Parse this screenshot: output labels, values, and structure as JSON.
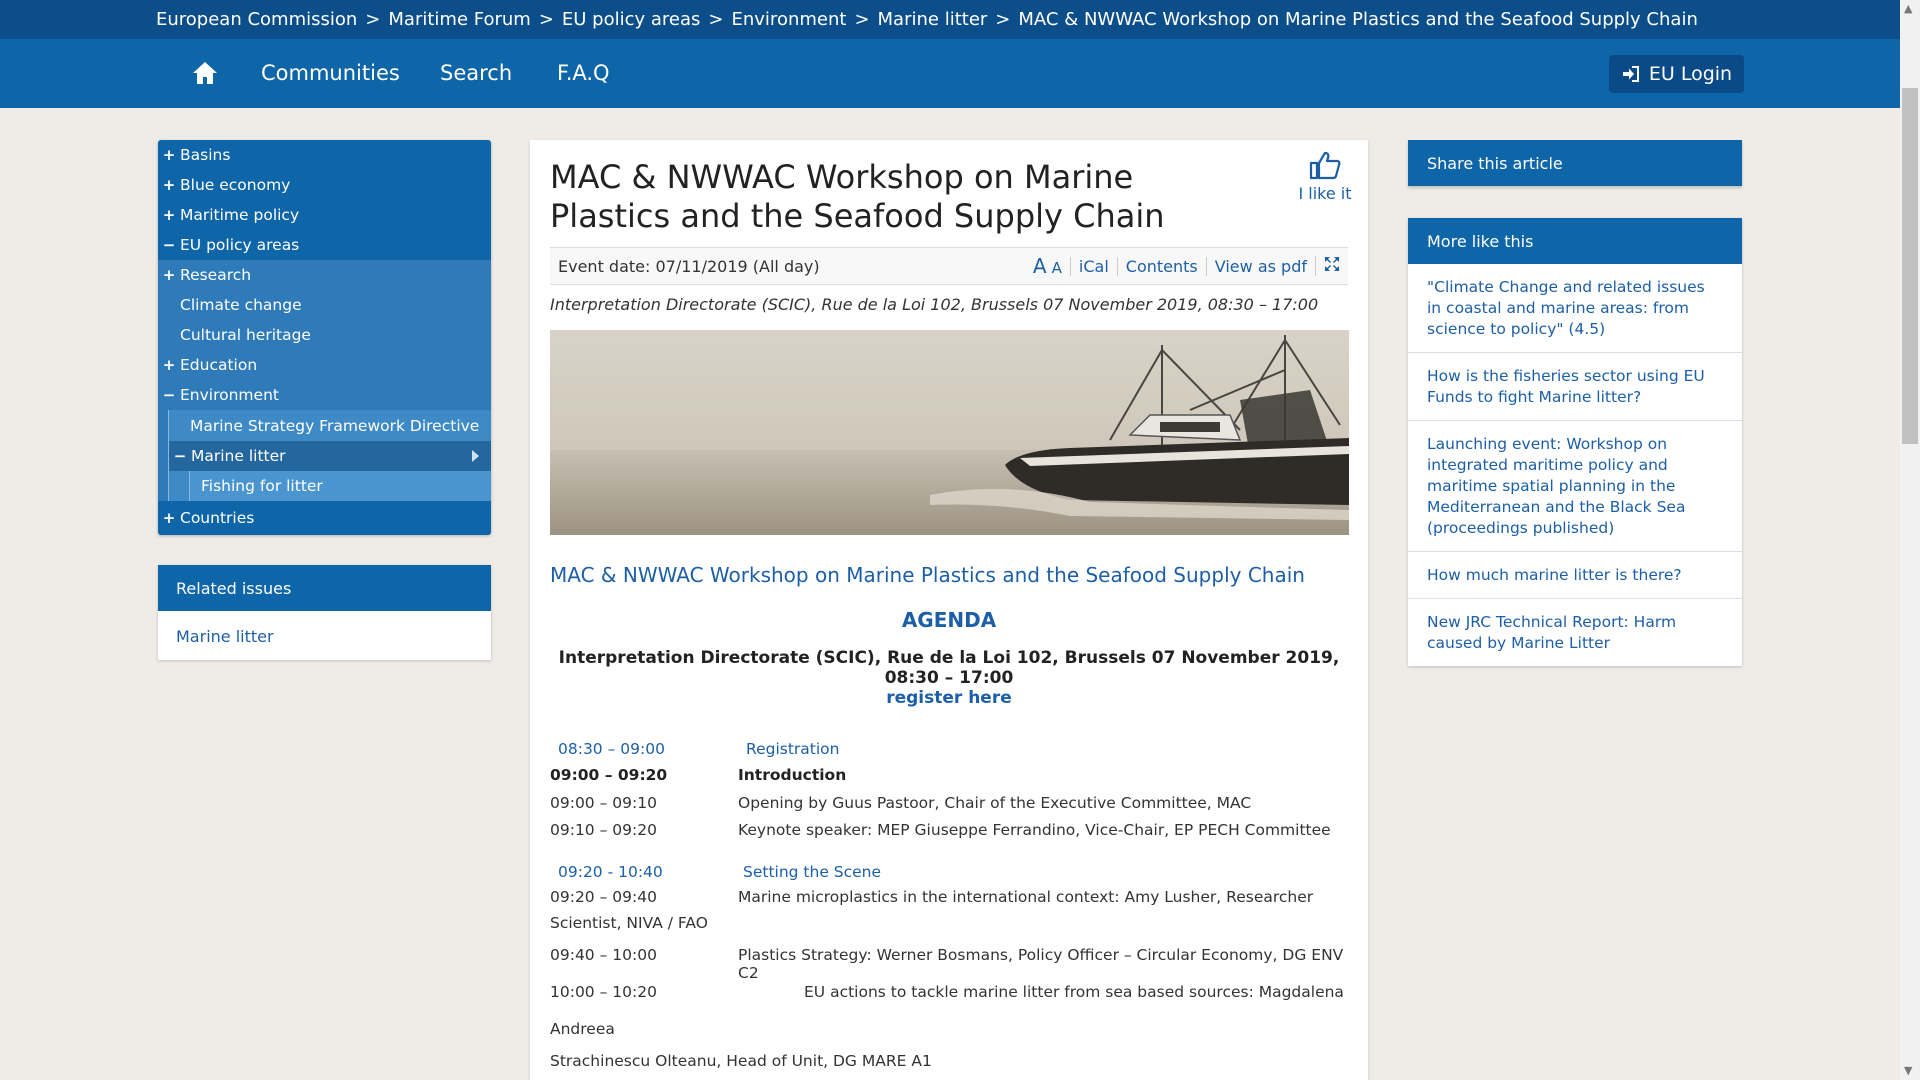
{
  "breadcrumb": [
    "European Commission",
    "Maritime Forum",
    "EU policy areas",
    "Environment",
    "Marine litter",
    "MAC & NWWAC Workshop on Marine Plastics and the Seafood Supply Chain"
  ],
  "breadcrumb_separator": ">",
  "nav": {
    "home_icon": "home-icon",
    "communities": "Communities",
    "search": "Search",
    "faq": "F.A.Q",
    "login": "EU Login"
  },
  "left_nav": {
    "basins": "Basins",
    "blue_economy": "Blue economy",
    "maritime_policy": "Maritime policy",
    "eu_policy_areas": "EU policy areas",
    "research": "Research",
    "climate_change": "Climate change",
    "cultural_heritage": "Cultural heritage",
    "education": "Education",
    "environment": "Environment",
    "msfd": "Marine Strategy Framework Directive",
    "marine_litter": "Marine litter",
    "fishing_for_litter": "Fishing for litter",
    "countries": "Countries"
  },
  "related": {
    "heading": "Related issues",
    "link": "Marine litter"
  },
  "article": {
    "title": "MAC & NWWAC Workshop on Marine Plastics and the Seafood Supply Chain",
    "like": "I like it",
    "event_date": "Event date: 07/11/2019 (All day)",
    "tools": {
      "font_small": "A",
      "font_large": "A",
      "ical": "iCal",
      "contents": "Contents",
      "pdf": "View as pdf"
    },
    "venue_italic": "Interpretation Directorate (SCIC), Rue de la Loi 102, Brussels 07 November 2019, 08:30 – 17:00",
    "event_link": "MAC & NWWAC Workshop on Marine Plastics and the Seafood Supply Chain",
    "agenda": "AGENDA",
    "venue_bold": "Interpretation Directorate (SCIC), Rue de la Loi 102, Brussels 07 November 2019, 08:30 – 17:00",
    "register": "register here",
    "rows": {
      "r1_time": "08:30 – 09:00",
      "r1_text": "Registration",
      "r2_time": "09:00 – 09:20",
      "r2_text": "Introduction",
      "r3_time": "09:00 – 09:10",
      "r3_text": "Opening by Guus Pastoor, Chair of the Executive Committee, MAC",
      "r4_time": "09:10 – 09:20",
      "r4_text": "Keynote speaker: MEP Giuseppe Ferrandino, Vice-Chair, EP PECH Committee",
      "r5_time": "09:20 - 10:40",
      "r5_text": "Setting the Scene",
      "r6_time": "09:20 – 09:40",
      "r6_text": "Marine microplastics in the international context: Amy Lusher, Researcher",
      "r6_cont": "Scientist, NIVA / FAO",
      "r7_time": "09:40 – 10:00",
      "r7_text": "Plastics Strategy: Werner Bosmans, Policy Officer – Circular Economy, DG ENV C2",
      "r8_time": "10:00 – 10:20",
      "r8_text": "EU actions to tackle marine litter from sea based sources: Magdalena",
      "r8_cont1": "Andreea",
      "r8_cont2": "Strachinescu Olteanu, Head of Unit, DG MARE A1"
    }
  },
  "share": "Share this article",
  "more": {
    "heading": "More like this",
    "items": [
      "\"Climate Change and related issues in coastal and marine areas: from science to policy\" (4.5)",
      "How is the fisheries sector using EU Funds to fight Marine litter?",
      "Launching event: Workshop on integrated maritime policy and maritime spatial planning in the Mediterranean and the Black Sea (proceedings published)",
      "How much marine litter is there?",
      "New JRC Technical Report: Harm caused by Marine Litter"
    ]
  }
}
